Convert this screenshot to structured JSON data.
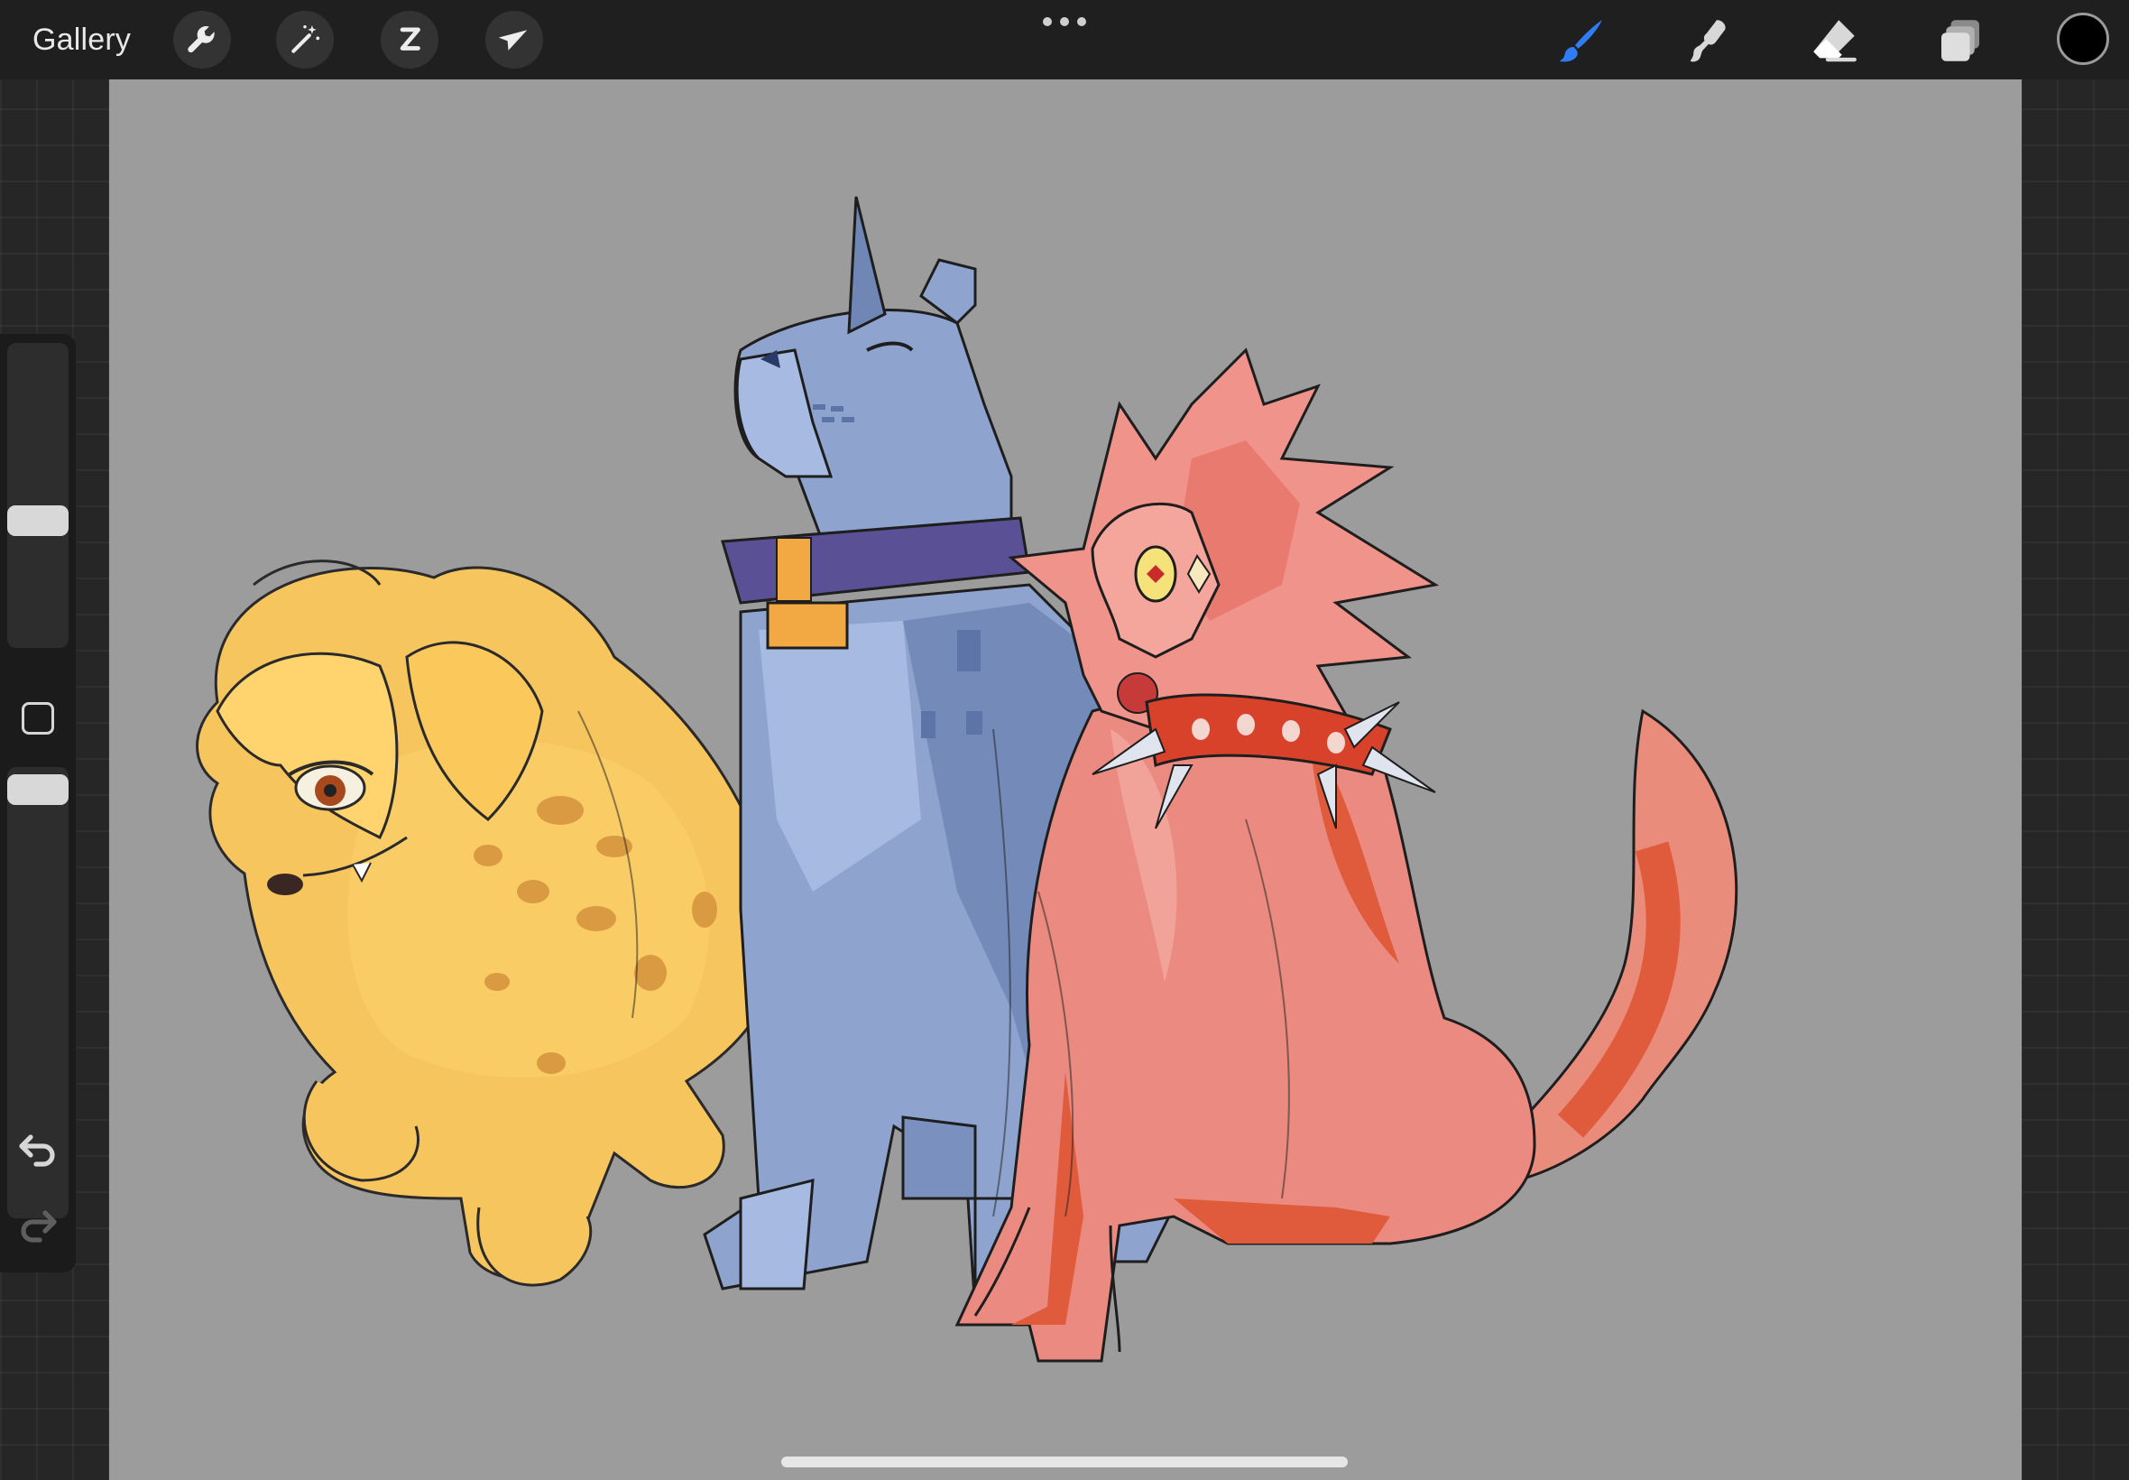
{
  "topbar": {
    "gallery_label": "Gallery",
    "left_tools": [
      "wrench-icon",
      "magic-wand-icon",
      "selection-icon",
      "transform-arrow-icon"
    ],
    "right_tools": [
      "brush-icon",
      "smudge-icon",
      "eraser-icon",
      "layers-icon"
    ],
    "active_tool": "brush",
    "accent_color": "#2f7cf6",
    "current_color": "#000000"
  },
  "sidebar": {
    "brush_size_level": 0.62,
    "opacity_level": 0.5,
    "icons": [
      "modify-square-icon",
      "undo-icon",
      "redo-icon"
    ]
  },
  "canvas": {
    "background_color": "#9c9c9c",
    "subject": [
      "yellow-spotted-dog",
      "blue-collared-dog",
      "red-spiky-dog"
    ]
  }
}
